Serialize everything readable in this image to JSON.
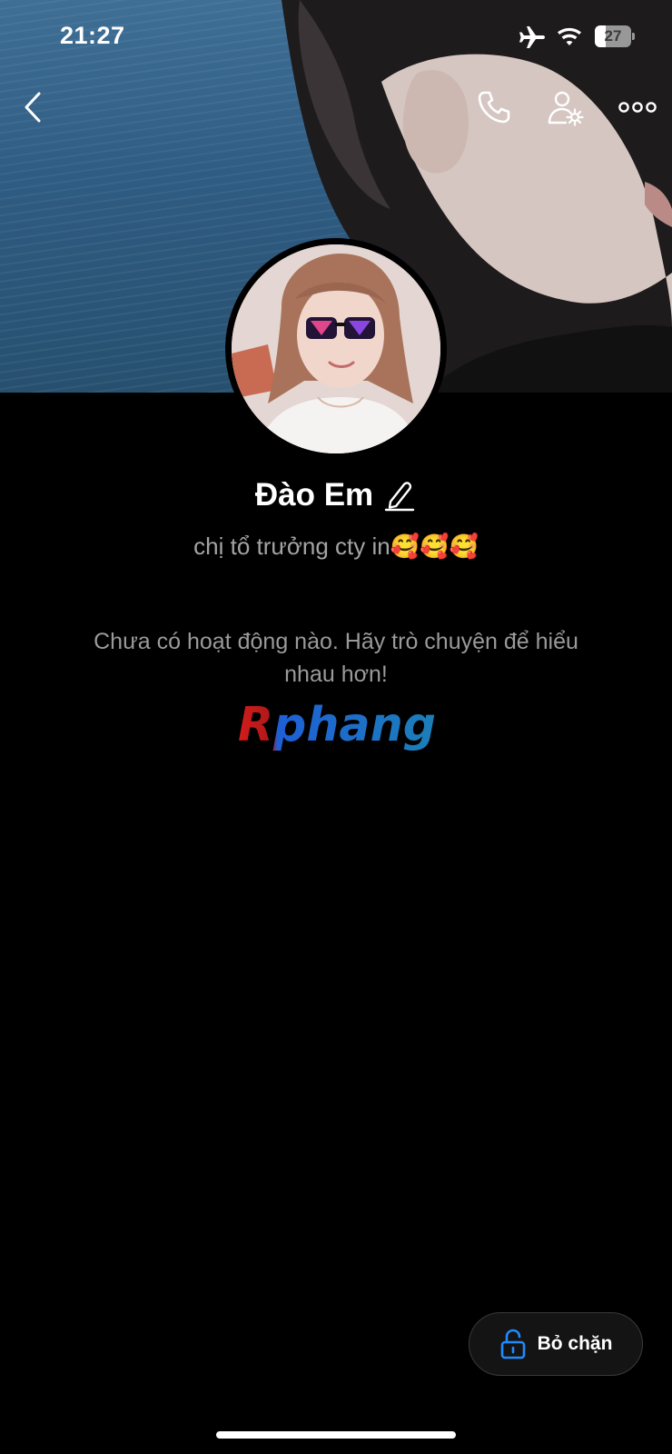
{
  "status_bar": {
    "time": "21:27",
    "battery_level": "27",
    "icons": [
      "airplane-icon",
      "wifi-icon",
      "battery-icon"
    ]
  },
  "header": {
    "icons": [
      "chevron-left-icon",
      "phone-icon",
      "user-settings-icon",
      "more-horizontal-icon"
    ]
  },
  "profile": {
    "name": "Đào Em",
    "bio": "chị tổ trưởng cty in🥰🥰🥰"
  },
  "activity": {
    "empty_message": "Chưa có hoạt động nào. Hãy trò chuyện để hiểu nhau hơn!"
  },
  "watermark": {
    "text": "Rphang"
  },
  "actions": {
    "unblock_label": "Bỏ chặn",
    "unblock_icon": "unlock-icon"
  },
  "colors": {
    "background": "#000000",
    "secondary_text": "#9a9a9a",
    "accent_blue": "#1f8bff"
  }
}
